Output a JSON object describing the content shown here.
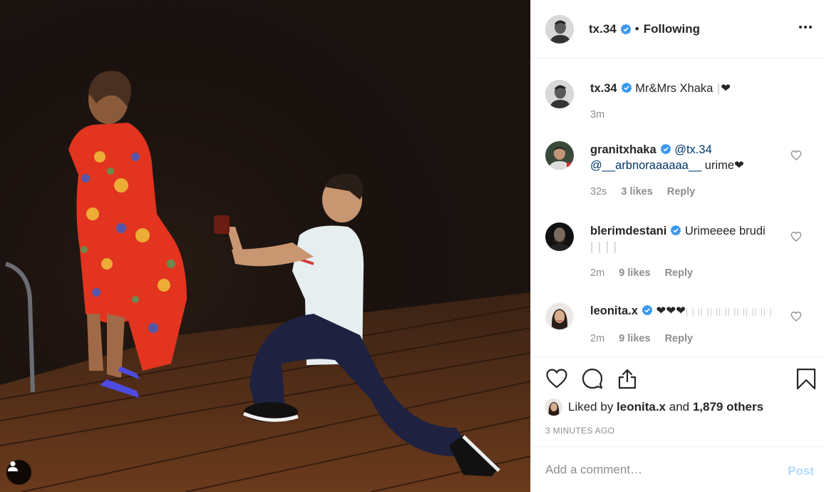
{
  "post": {
    "image_alt": "Man kneeling with ring box proposing to a woman in a red floral dress on a wooden dock at night",
    "owner": "tx.34",
    "follow_state": "Following",
    "separator": "•"
  },
  "caption": {
    "user": "tx.34",
    "text": "Mr&Mrs Xhaka",
    "suffix": "❤",
    "time": "3m"
  },
  "comments": [
    {
      "user": "granitxhaka",
      "verified": true,
      "mention1": "@tx.34",
      "mention2": "@__arbnoraaaaaa__",
      "text": " urime❤",
      "time": "32s",
      "likes": "3 likes",
      "reply": "Reply"
    },
    {
      "user": "blerimdestani",
      "verified": true,
      "text": "Urimeeee brudi",
      "faint": "| | | |",
      "time": "2m",
      "likes": "9 likes",
      "reply": "Reply"
    },
    {
      "user": "leonita.x",
      "verified": true,
      "text": "❤❤❤",
      "faint": "| | || || || || || || || || |",
      "time": "2m",
      "likes": "9 likes",
      "reply": "Reply"
    }
  ],
  "likes": {
    "prefix": "Liked by ",
    "user": "leonita.x",
    "middle": " and ",
    "others": "1,879 others"
  },
  "timestamp": "3 MINUTES AGO",
  "comment_input": {
    "placeholder": "Add a comment…"
  },
  "post_button": "Post",
  "colors": {
    "verified": "#3897f0",
    "link": "#00376b",
    "post_disabled": "#b3dbff",
    "meta": "#8e8e8e"
  },
  "icons": [
    "user-tag-icon",
    "more-options-icon",
    "verified-badge-icon",
    "heart-icon",
    "comment-icon",
    "share-icon",
    "bookmark-icon"
  ]
}
